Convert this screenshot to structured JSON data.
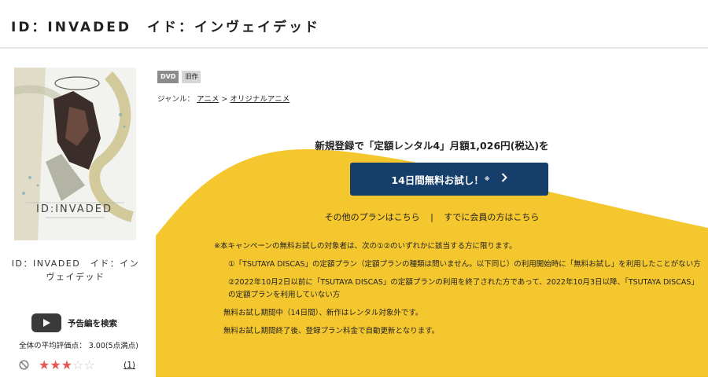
{
  "header": {
    "title": "ID：INVADED　イド：インヴェイデッド"
  },
  "item": {
    "name": "ID：INVADED　イド：インヴェイデッド",
    "jacket_logo": "ID:INVADED",
    "trailer_label": "予告編を検索",
    "rating_text": "全体の平均評価点： 3.00(5点満点)",
    "rating_value": 3,
    "rating_max": 5,
    "review_count": "(1)"
  },
  "badges": [
    "DVD",
    "旧作"
  ],
  "genre": {
    "label": "ジャンル：",
    "items": [
      "アニメ",
      "オリジナルアニメ"
    ],
    "separator": ">"
  },
  "campaign": {
    "headline": "新規登録で「定額レンタル4」月額1,026円(税込)を",
    "cta_label": "14日間無料お試し！",
    "cta_mark": "※",
    "link_other": "その他のプランはこちら",
    "link_sep": "|",
    "link_member": "すでに会員の方はこちら",
    "notes": {
      "intro": "※本キャンペーンの無料お試しの対象者は、次の①②のいずれかに該当する方に限ります。",
      "cond1": "①「TSUTAYA DISCAS」の定額プラン（定額プランの種類は問いません。以下同じ）の利用開始時に「無料お試し」を利用したことがない方",
      "cond2": "②2022年10月2日以前に「TSUTAYA DISCAS」の定額プランの利用を終了された方であって、2022年10月3日以降、「TSUTAYA DISCAS」の定額プランを利用していない方",
      "note1": "無料お試し期間中（14日間）、新作はレンタル対象外です。",
      "note2": "無料お試し期間終了後、登録プラン料金で自動更新となります。"
    }
  },
  "colors": {
    "accent_yellow": "#f5c72f",
    "cta_navy": "#163e6a",
    "star_red": "#e45a52"
  },
  "icons": [
    "play-icon",
    "no-entry-icon",
    "star-icon",
    "chevron-right-icon"
  ]
}
